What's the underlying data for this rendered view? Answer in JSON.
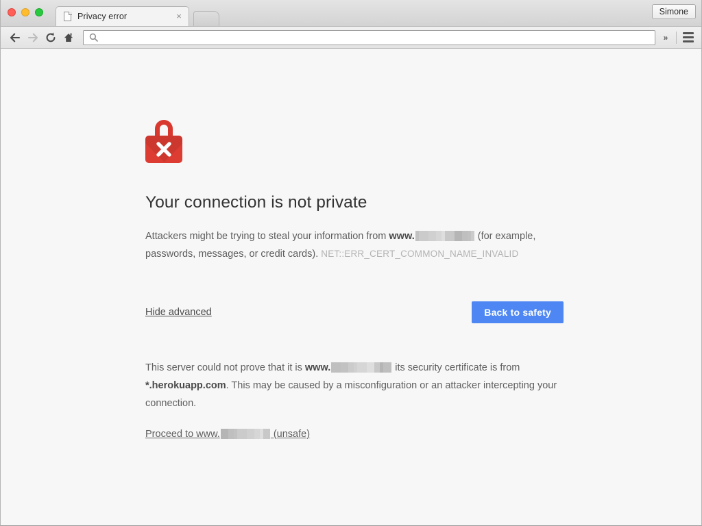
{
  "window": {
    "traffic_lights": [
      "close",
      "minimize",
      "zoom"
    ],
    "profile_label": "Simone"
  },
  "tab": {
    "title": "Privacy error",
    "favicon": "page-icon",
    "close_label": "×",
    "new_tab_label": ""
  },
  "toolbar": {
    "back_icon": "back-arrow-icon",
    "forward_icon": "forward-arrow-icon",
    "reload_icon": "reload-icon",
    "home_icon": "home-icon",
    "overflow_label": "»",
    "menu_icon": "hamburger-menu-icon"
  },
  "omnibox": {
    "value": "",
    "placeholder": "",
    "icon": "search-icon"
  },
  "interstitial": {
    "icon": "lock-error-icon",
    "icon_color": "#dc3c32",
    "title": "Your connection is not private",
    "paragraph_prefix": "Attackers might be trying to steal your information from ",
    "domain_bold": "www.",
    "domain_redacted": true,
    "paragraph_suffix": " (for example, passwords, messages, or credit cards). ",
    "error_code": "NET::ERR_CERT_COMMON_NAME_INVALID",
    "hide_advanced_label": "Hide advanced",
    "back_to_safety_label": "Back to safety",
    "back_to_safety_color": "#4e87f3",
    "advanced_prefix": "This server could not prove that it is ",
    "advanced_domain_bold": "www.",
    "advanced_middle": " its security certificate is from ",
    "cert_domain": "*.herokuapp.com",
    "advanced_suffix": ". This may be caused by a misconfiguration or an attacker intercepting your connection.",
    "proceed_prefix": "Proceed to www.",
    "proceed_suffix": " (unsafe)"
  }
}
